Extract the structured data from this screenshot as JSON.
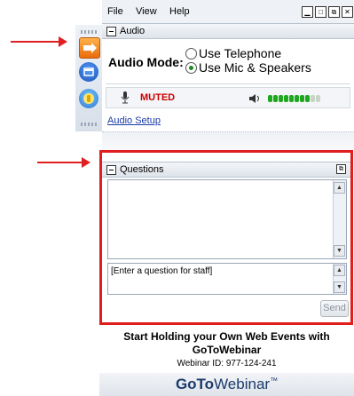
{
  "menu": {
    "file": "File",
    "view": "View",
    "help": "Help"
  },
  "audio": {
    "title": "Audio",
    "mode_label": "Audio Mode:",
    "options": [
      "Use Telephone",
      "Use Mic & Speakers"
    ],
    "selected_option": "Use Mic & Speakers",
    "status": "MUTED",
    "setup_link": "Audio Setup",
    "input_level": 0.8
  },
  "questions": {
    "title": "Questions",
    "placeholder": "[Enter a question for staff]",
    "send_label": "Send"
  },
  "footer": {
    "promo_line1": "Start Holding your Own Web Events with",
    "promo_line2": "GoToWebinar",
    "webinar_id": "Webinar ID: 977-124-241",
    "brand_go": "GoTo",
    "brand_rest": "Webinar",
    "brand_tm": "™"
  },
  "colors": {
    "annotation": "#e02020",
    "muted": "#cc0000",
    "meter_on": "#1fa81f",
    "meter_off": "#c8d4c8",
    "link": "#1a3ca8",
    "brand": "#1b3a6b"
  },
  "icons": {
    "toolbar": [
      "arrow-right-icon",
      "window-icon",
      "help-icon"
    ],
    "mic": "microphone-icon",
    "speaker": "speaker-icon"
  }
}
